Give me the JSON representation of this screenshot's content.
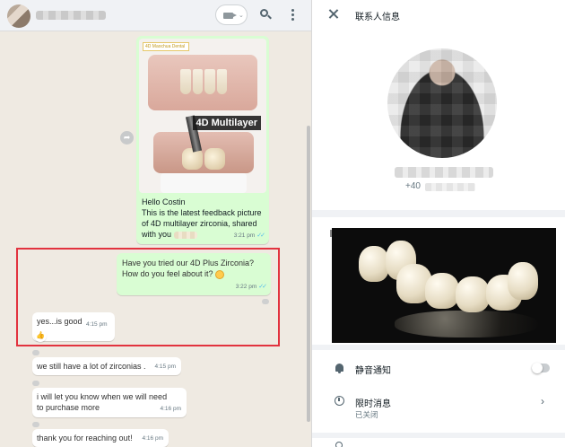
{
  "chat": {
    "image_message": {
      "logo_text": "4D Maochua Dental",
      "image_label": "4D Multilayer",
      "greeting": "Hello Costin",
      "text": "This is the latest feedback picture of 4D multilayer zirconia, shared with you",
      "time": "3:21 pm"
    },
    "messages": [
      {
        "text": "Have you tried our 4D Plus Zirconia?",
        "text2": "How do you feel about it?",
        "time": "3:22 pm"
      },
      {
        "text": "yes...is good",
        "time": "4:15 pm"
      },
      {
        "text": "we still have a lot of zirconias .",
        "time": "4:15 pm"
      },
      {
        "text": "i will let you know when we will need",
        "text2": "to purchase more",
        "time": "4:16 pm"
      },
      {
        "text": "thank you for reaching out!",
        "time": "4:16 pm"
      }
    ],
    "reaction": "👍",
    "ticks": "✓✓"
  },
  "info": {
    "title": "联系人信息",
    "phone_prefix": "+40",
    "mute_label": "静音通知",
    "timer_label": "限时消息",
    "timer_sub": "已关闭",
    "chevron": "›"
  },
  "colors": {
    "outgoing_bubble": "#d9fdd3",
    "incoming_bubble": "#ffffff",
    "chat_bg": "#efeae2",
    "highlight_border": "#e2333f",
    "read_ticks": "#53bdeb"
  }
}
